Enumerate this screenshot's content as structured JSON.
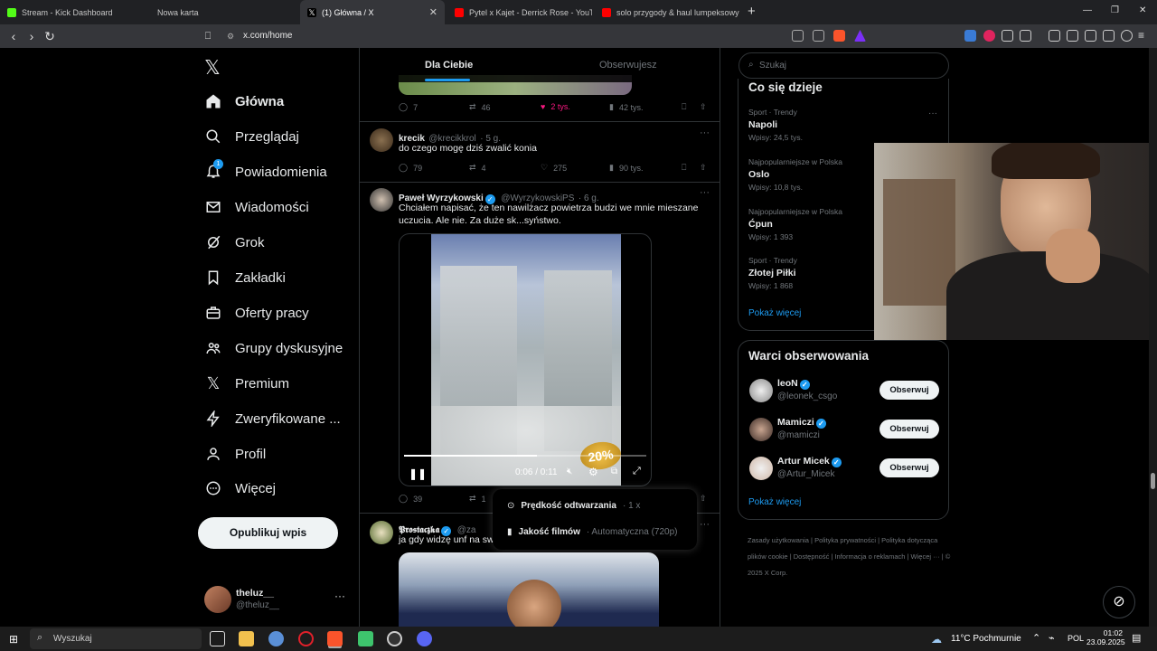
{
  "browser": {
    "tabs": [
      {
        "title": "Stream - Kick Dashboard",
        "color": "#53fc18"
      },
      {
        "title": "Nowa karta",
        "color": ""
      },
      {
        "title": "(1) Główna / X",
        "color": "#ffffff"
      },
      {
        "title": "Pytel x Kajet - Derrick Rose - YouTube",
        "color": "#ff0000"
      },
      {
        "title": "solo przygody & haul lumpeksowy -",
        "color": "#ff0000"
      }
    ],
    "new_tab": "+",
    "url": "x.com/home"
  },
  "nav": {
    "items": [
      {
        "label": "Główna",
        "icon": "home-icon"
      },
      {
        "label": "Przeglądaj",
        "icon": "search-icon"
      },
      {
        "label": "Powiadomienia",
        "icon": "bell-icon",
        "badge": "1"
      },
      {
        "label": "Wiadomości",
        "icon": "mail-icon"
      },
      {
        "label": "Grok",
        "icon": "grok-icon"
      },
      {
        "label": "Zakładki",
        "icon": "bookmark-icon"
      },
      {
        "label": "Oferty pracy",
        "icon": "briefcase-icon"
      },
      {
        "label": "Grupy dyskusyjne",
        "icon": "people-icon"
      },
      {
        "label": "Premium",
        "icon": "x-logo-icon"
      },
      {
        "label": "Zweryfikowane ...",
        "icon": "lightning-icon"
      },
      {
        "label": "Profil",
        "icon": "person-icon"
      },
      {
        "label": "Więcej",
        "icon": "more-circle-icon"
      }
    ],
    "post_button": "Opublikuj wpis",
    "profile": {
      "name": "theluz__",
      "handle": "@theluz__"
    }
  },
  "feed": {
    "tabs": [
      "Dla Ciebie",
      "Obserwujesz"
    ],
    "tweet0_stats": {
      "replies": "7",
      "retweets": "46",
      "likes": "2 tys.",
      "views": "42 tys."
    },
    "tweets": [
      {
        "name": "krecik",
        "handle": "@krecikkrol",
        "time": "· 5 g.",
        "text": "do czego mogę dziś zwalić konia",
        "replies": "79",
        "retweets": "4",
        "likes": "275",
        "views": "90 tys."
      },
      {
        "name": "Paweł Wyrzykowski",
        "handle": "@WyrzykowskiPS",
        "time": "· 6 g.",
        "text": "Chciałem napisać, że ten nawilżacz powietrza budzi we mnie mieszane uczucia. Ale nie. Za duże sk...syństwo.",
        "replies": "39",
        "retweets": "1",
        "video": {
          "time": "0:06 / 0:11",
          "progress": 0.55,
          "watermark": "20%"
        }
      },
      {
        "name": "𝕻𝖗𝖔𝖘𝖙𝖆𝖈𝖟𝖐𝖆",
        "handle": "@za",
        "text": "ja gdy widzę unf na swe"
      }
    ],
    "settings_menu": {
      "speed_label": "Prędkość odtwarzania",
      "speed_value": "· 1 x",
      "quality_label": "Jakość filmów",
      "quality_value": "· Automatyczna (720p)"
    }
  },
  "right": {
    "search_placeholder": "Szukaj",
    "trends_title": "Co się dzieje",
    "trends": [
      {
        "category": "Sport · Trendy",
        "name": "Napoli",
        "posts": "Wpisy: 24,5 tys."
      },
      {
        "category": "Najpopularniejsze w Polska",
        "name": "Oslo",
        "posts": "Wpisy: 10,8 tys."
      },
      {
        "category": "Najpopularniejsze w Polska",
        "name": "Ćpun",
        "posts": "Wpisy: 1 393"
      },
      {
        "category": "Sport · Trendy",
        "name": "Złotej Piłki",
        "posts": "Wpisy: 1 868"
      }
    ],
    "show_more": "Pokaż więcej",
    "who_title": "Warci obserwowania",
    "who": [
      {
        "name": "leoN",
        "handle": "@leonek_csgo",
        "button": "Obserwuj"
      },
      {
        "name": "Mamiczi",
        "handle": "@mamiczi",
        "button": "Obserwuj"
      },
      {
        "name": "Artur Micek",
        "handle": "@Artur_Micek",
        "button": "Obserwuj"
      }
    ],
    "show_more2": "Pokaż więcej",
    "footer": [
      "Zasady użytkowania",
      "Polityka prywatności",
      "Polityka dotycząca plików cookie",
      "Dostępność",
      "Informacja o reklamach",
      "Więcej ···",
      "© 2025 X Corp."
    ]
  },
  "taskbar": {
    "search": "Wyszukaj",
    "weather": "11°C Pochmurnie",
    "lang": "POL",
    "time": "01:02",
    "date": "23.09.2025"
  }
}
